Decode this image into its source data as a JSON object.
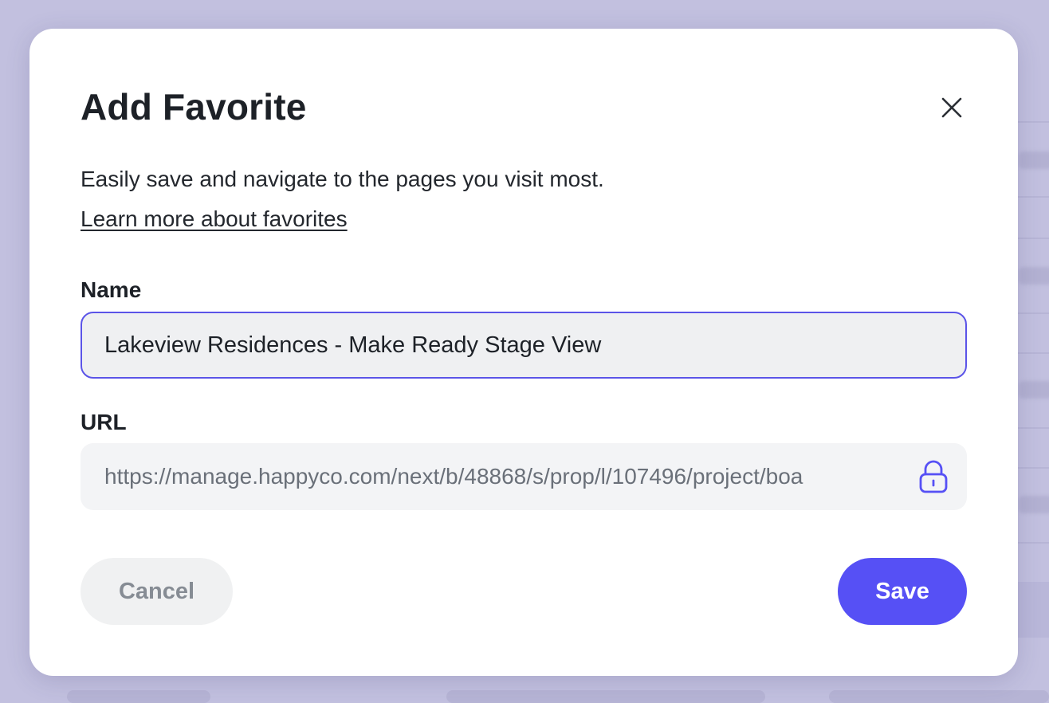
{
  "dialog": {
    "title": "Add Favorite",
    "description": "Easily save and navigate to the pages you visit most.",
    "learn_more_link": "Learn more about favorites",
    "close_icon": "close-icon"
  },
  "name_field": {
    "label": "Name",
    "value": "Lakeview Residences - Make Ready Stage View"
  },
  "url_field": {
    "label": "URL",
    "value": "https://manage.happyco.com/next/b/48868/s/prop/l/107496/project/boa",
    "locked": true,
    "lock_icon": "lock-icon"
  },
  "actions": {
    "cancel_label": "Cancel",
    "save_label": "Save"
  },
  "colors": {
    "accent": "#5650f5",
    "focus_border": "#5b54e8",
    "overlay": "#c2c0df",
    "title_text": "#1d2127",
    "muted_text": "#6a7079"
  }
}
